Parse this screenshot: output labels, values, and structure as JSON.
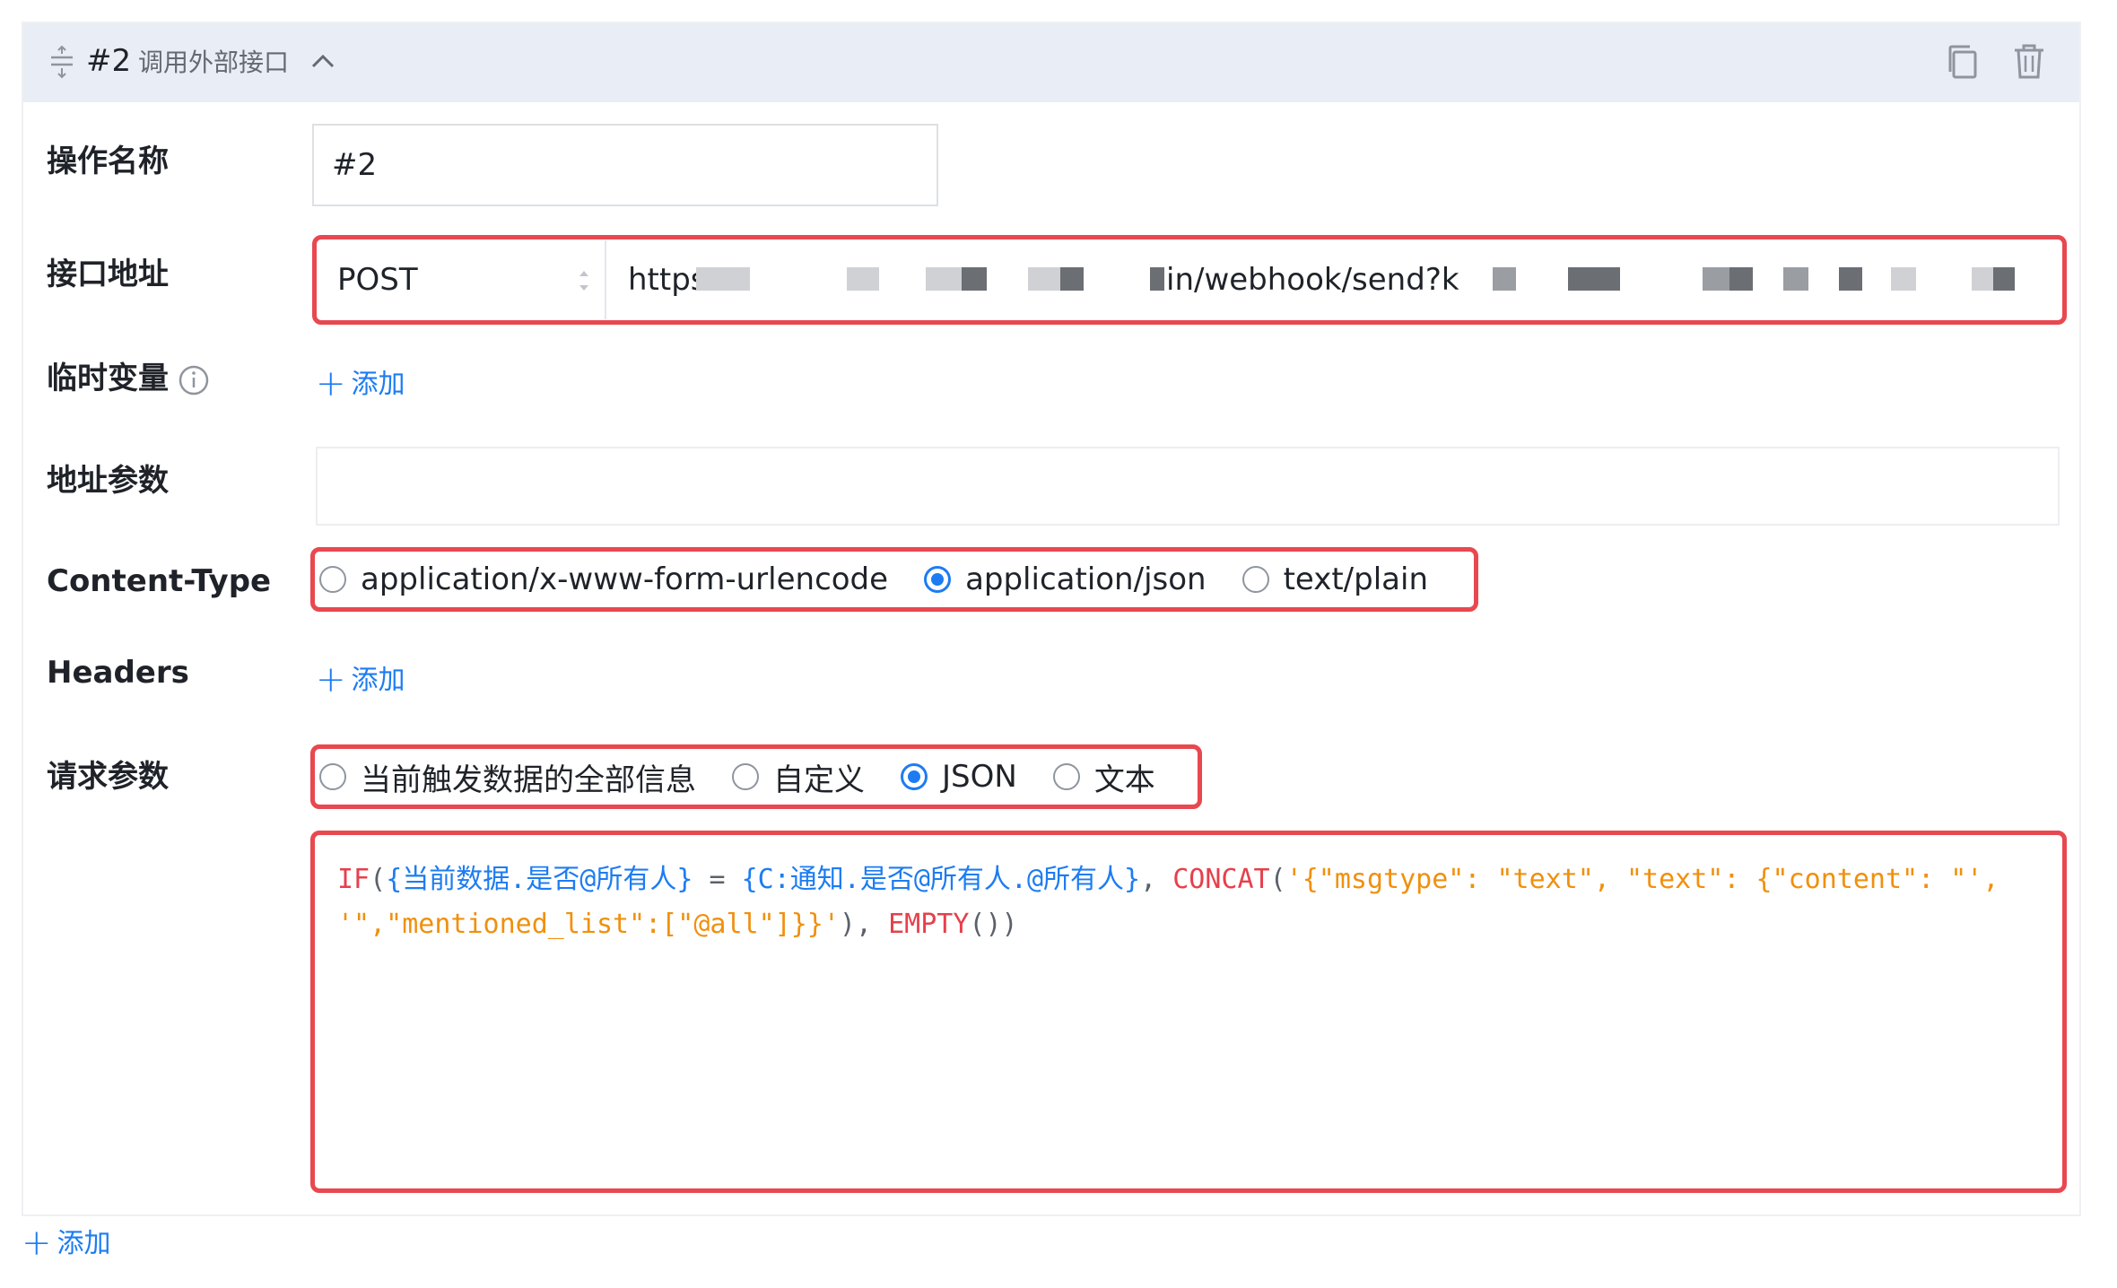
{
  "operation": {
    "index": "#2",
    "type_label": "调用外部接口",
    "icons": {
      "drag": "drag-handle-icon",
      "collapse": "chevron-up-icon",
      "copy": "copy-icon",
      "delete": "trash-icon"
    }
  },
  "fields": {
    "name": {
      "label": "操作名称",
      "value": "#2"
    },
    "url": {
      "label": "接口地址",
      "method": "POST",
      "value_start": "https:",
      "value_middle": "in/webhook/send?k"
    },
    "temp_vars": {
      "label": "临时变量",
      "add_label": "添加"
    },
    "url_params": {
      "label": "地址参数"
    },
    "content_type": {
      "label": "Content-Type",
      "options": [
        "application/x-www-form-urlencode",
        "application/json",
        "text/plain"
      ],
      "selected": "application/json"
    },
    "headers": {
      "label": "Headers",
      "add_label": "添加"
    },
    "request_params": {
      "label": "请求参数",
      "options": [
        "当前触发数据的全部信息",
        "自定义",
        "JSON",
        "文本"
      ],
      "selected": "JSON"
    }
  },
  "code": {
    "t1": "IF",
    "t2": "(",
    "t3": "{当前数据.是否@所有人}",
    "t4": " = ",
    "t5": "{C:通知.是否@所有人.@所有人}",
    "t6": ", ",
    "t7": "CONCAT",
    "t8": "(",
    "t9": "'{\"msgtype\": \"text\", \"text\": {\"content\": \"', '\",\"mentioned_list\":[\"@all\"]}}'",
    "t10": "), ",
    "t11": "EMPTY",
    "t12": "())"
  },
  "footer": {
    "add_label": "添加"
  },
  "colors": {
    "accent": "#1d7cf2",
    "highlight_border": "#e8484f",
    "header_bg": "#e9edf5",
    "code_function": "#e6404c",
    "code_field": "#1d7cf2",
    "code_string": "#f0900d"
  }
}
